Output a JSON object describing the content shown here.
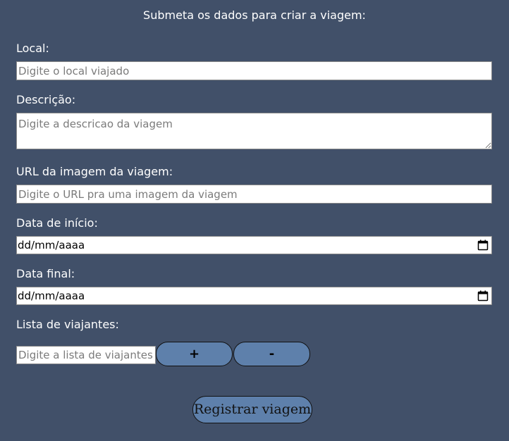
{
  "form": {
    "heading": "Submeta os dados para criar a viagem:",
    "local": {
      "label": "Local:",
      "placeholder": "Digite o local viajado",
      "value": ""
    },
    "descricao": {
      "label": "Descrição:",
      "placeholder": "Digite a descricao da viagem",
      "value": ""
    },
    "imagem": {
      "label": "URL da imagem da viagem:",
      "placeholder": "Digite o URL pra uma imagem da viagem",
      "value": ""
    },
    "data_inicio": {
      "label": "Data de início:",
      "value": "dd/mm/aaaa",
      "icon": "calendar-icon"
    },
    "data_final": {
      "label": "Data final:",
      "value": "dd/mm/aaaa",
      "icon": "calendar-icon"
    },
    "viajantes": {
      "label": "Lista de viajantes:",
      "placeholder": "Digite a lista de viajantes",
      "add_label": "+",
      "remove_label": "-"
    },
    "submit_label": "Registrar viagem"
  },
  "colors": {
    "background": "#415069",
    "button": "#5e80ab",
    "text": "#ffffff"
  }
}
